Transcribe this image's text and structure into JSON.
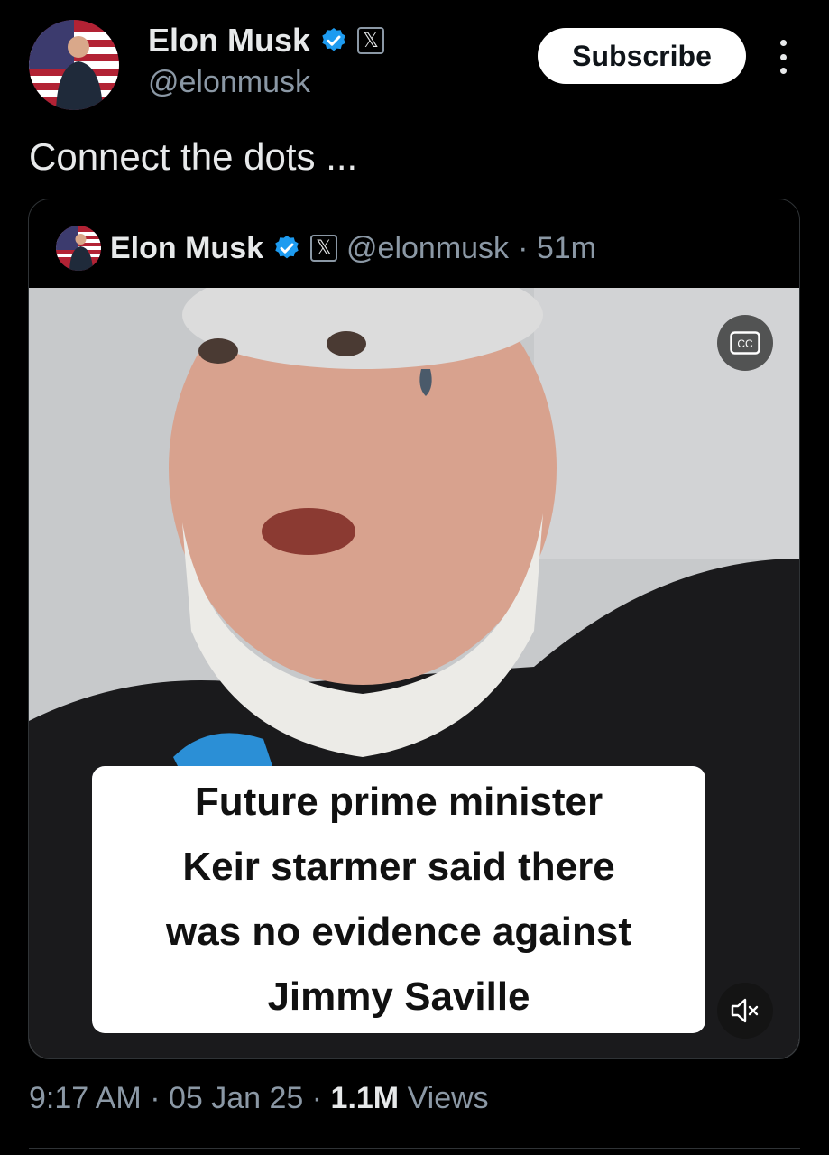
{
  "author": {
    "name": "Elon Musk",
    "handle": "@elonmusk"
  },
  "header": {
    "subscribe_label": "Subscribe",
    "x_badge": "𝕏"
  },
  "tweet": {
    "text": "Connect the dots ..."
  },
  "quoted": {
    "name": "Elon Musk",
    "x_badge": "𝕏",
    "handle": "@elonmusk",
    "time": "· 51m",
    "caption_lines": [
      "Future prime minister",
      "Keir starmer said there",
      "was no evidence against",
      "Jimmy Saville"
    ],
    "cc_label": "CC"
  },
  "meta": {
    "time": "9:17 AM",
    "sep1": " · ",
    "date": "05 Jan 25",
    "sep2": " · ",
    "views_count": "1.1M",
    "views_label": " Views"
  },
  "colors": {
    "verified": "#1d9bf0",
    "background": "#000000",
    "muted_text": "#8b98a5"
  },
  "icons": [
    "verified-badge-icon",
    "x-logo-icon",
    "more-icon",
    "closed-captions-icon",
    "muted-volume-icon"
  ]
}
